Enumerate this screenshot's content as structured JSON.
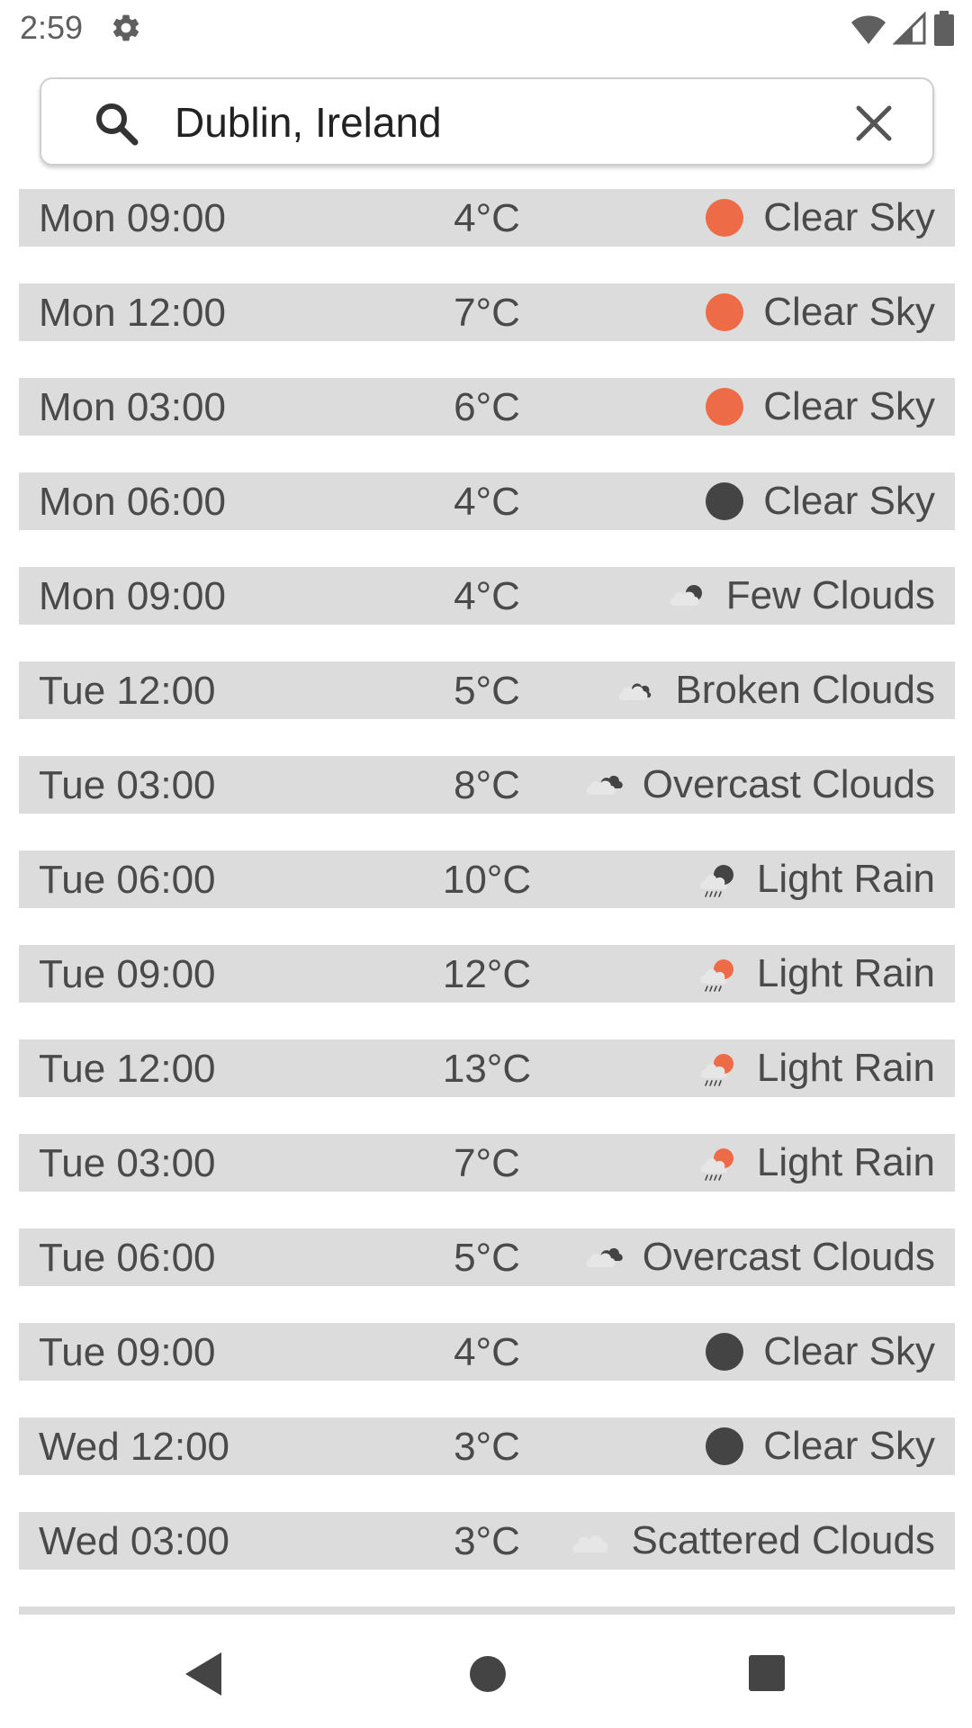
{
  "status_bar": {
    "time": "2:59",
    "icons": [
      "gear-icon",
      "wifi-icon",
      "cell-signal-icon",
      "battery-icon"
    ]
  },
  "search": {
    "value": "Dublin, Ireland",
    "icon": "search-icon",
    "clear_icon": "close-icon"
  },
  "colors": {
    "row_background": "#dcdcdc",
    "sun": "#ee6b47",
    "moon": "#444444",
    "cloud": "#e6e6e6",
    "text": "#4a4a4a"
  },
  "forecast": [
    {
      "time": "Mon 09:00",
      "temp": "4°C",
      "condition": "Clear Sky",
      "icon": "sun-icon"
    },
    {
      "time": "Mon 12:00",
      "temp": "7°C",
      "condition": "Clear Sky",
      "icon": "sun-icon"
    },
    {
      "time": "Mon 03:00",
      "temp": "6°C",
      "condition": "Clear Sky",
      "icon": "sun-icon"
    },
    {
      "time": "Mon 06:00",
      "temp": "4°C",
      "condition": "Clear Sky",
      "icon": "moon-icon"
    },
    {
      "time": "Mon 09:00",
      "temp": "4°C",
      "condition": "Few Clouds",
      "icon": "cloud-night-icon"
    },
    {
      "time": "Tue 12:00",
      "temp": "5°C",
      "condition": "Broken Clouds",
      "icon": "broken-clouds-icon"
    },
    {
      "time": "Tue 03:00",
      "temp": "8°C",
      "condition": "Overcast Clouds",
      "icon": "overcast-clouds-icon"
    },
    {
      "time": "Tue 06:00",
      "temp": "10°C",
      "condition": "Light Rain",
      "icon": "rain-night-icon"
    },
    {
      "time": "Tue 09:00",
      "temp": "12°C",
      "condition": "Light Rain",
      "icon": "rain-day-icon"
    },
    {
      "time": "Tue 12:00",
      "temp": "13°C",
      "condition": "Light Rain",
      "icon": "rain-day-icon"
    },
    {
      "time": "Tue 03:00",
      "temp": "7°C",
      "condition": "Light Rain",
      "icon": "rain-day-icon"
    },
    {
      "time": "Tue 06:00",
      "temp": "5°C",
      "condition": "Overcast Clouds",
      "icon": "overcast-clouds-icon"
    },
    {
      "time": "Tue 09:00",
      "temp": "4°C",
      "condition": "Clear Sky",
      "icon": "moon-icon"
    },
    {
      "time": "Wed 12:00",
      "temp": "3°C",
      "condition": "Clear Sky",
      "icon": "moon-icon"
    },
    {
      "time": "Wed 03:00",
      "temp": "3°C",
      "condition": "Scattered Clouds",
      "icon": "scattered-clouds-icon"
    },
    {
      "time": "",
      "temp": "",
      "condition": "",
      "icon": ""
    }
  ],
  "nav_bar": {
    "icons": [
      "back-icon",
      "home-icon",
      "recents-icon"
    ]
  }
}
